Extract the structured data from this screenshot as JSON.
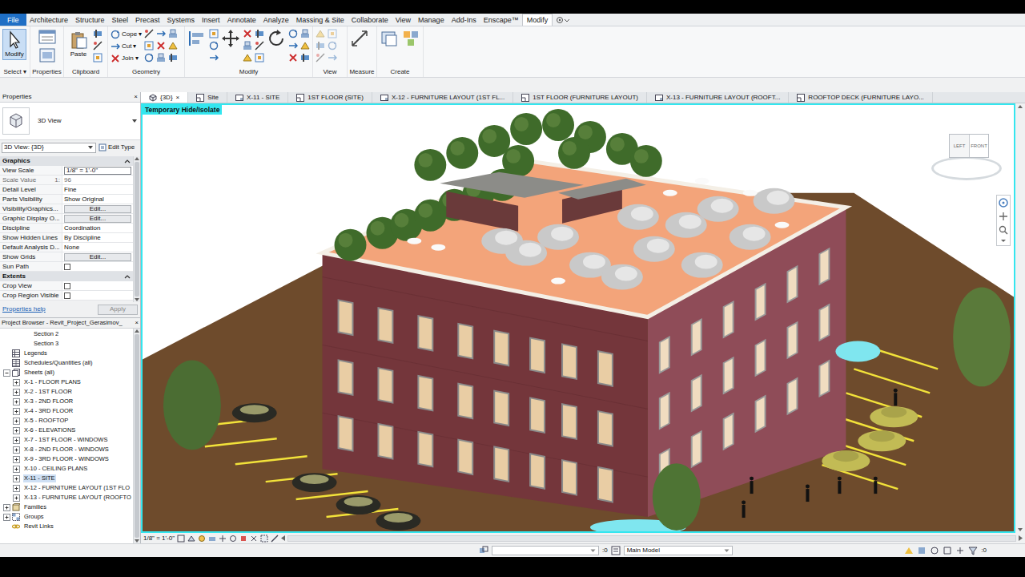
{
  "ribbon": {
    "file_tab": "File",
    "tabs": [
      {
        "label": "Architecture",
        "selected": false
      },
      {
        "label": "Structure",
        "selected": false
      },
      {
        "label": "Steel",
        "selected": false
      },
      {
        "label": "Precast",
        "selected": false
      },
      {
        "label": "Systems",
        "selected": false
      },
      {
        "label": "Insert",
        "selected": false
      },
      {
        "label": "Annotate",
        "selected": false
      },
      {
        "label": "Analyze",
        "selected": false
      },
      {
        "label": "Massing & Site",
        "selected": false
      },
      {
        "label": "Collaborate",
        "selected": false
      },
      {
        "label": "View",
        "selected": false
      },
      {
        "label": "Manage",
        "selected": false
      },
      {
        "label": "Add-Ins",
        "selected": false
      },
      {
        "label": "Enscape™",
        "selected": false
      },
      {
        "label": "Modify",
        "selected": true
      }
    ],
    "groups": [
      {
        "label": "Select",
        "dropdown": "▾",
        "tools": [
          {
            "label": "Modify",
            "selected": true
          }
        ]
      },
      {
        "label": "Properties",
        "tools": []
      },
      {
        "label": "Clipboard",
        "tools": [
          {
            "label": "Paste",
            "selected": false
          }
        ]
      },
      {
        "label": "Geometry",
        "tools": [
          {
            "label": "Cope",
            "dropdown": "▾",
            "selected": false
          },
          {
            "label": "Cut",
            "dropdown": "▾",
            "selected": false
          },
          {
            "label": "Join",
            "dropdown": "▾",
            "selected": false
          }
        ]
      },
      {
        "label": "Modify",
        "tools": []
      },
      {
        "label": "View",
        "tools": []
      },
      {
        "label": "Measure",
        "tools": []
      },
      {
        "label": "Create",
        "tools": []
      }
    ]
  },
  "properties": {
    "title": "Properties",
    "close": "×",
    "type_name": "3D View",
    "view_selector": "3D View: {3D}",
    "edit_type": "Edit Type",
    "sections": [
      {
        "label": "Graphics",
        "expanded": true,
        "rows": [
          {
            "name": "View Scale",
            "value": "1/8\" = 1'-0\"",
            "kind": "field",
            "disabled": false
          },
          {
            "name": "Scale Value",
            "prefix": "1:",
            "value": "96",
            "kind": "text",
            "disabled": true
          },
          {
            "name": "Detail Level",
            "value": "Fine",
            "kind": "text",
            "disabled": false
          },
          {
            "name": "Parts Visibility",
            "value": "Show Original",
            "kind": "text",
            "disabled": false
          },
          {
            "name": "Visibility/Graphics...",
            "value": "Edit...",
            "kind": "button",
            "disabled": false
          },
          {
            "name": "Graphic Display O...",
            "value": "Edit...",
            "kind": "button",
            "disabled": false
          },
          {
            "name": "Discipline",
            "value": "Coordination",
            "kind": "text",
            "disabled": false
          },
          {
            "name": "Show Hidden Lines",
            "value": "By Discipline",
            "kind": "text",
            "disabled": false
          },
          {
            "name": "Default Analysis D...",
            "value": "None",
            "kind": "text",
            "disabled": false
          },
          {
            "name": "Show Grids",
            "value": "Edit...",
            "kind": "button",
            "disabled": false
          },
          {
            "name": "Sun Path",
            "kind": "checkbox",
            "checked": false,
            "disabled": false
          }
        ]
      },
      {
        "label": "Extents",
        "expanded": true,
        "rows": [
          {
            "name": "Crop View",
            "kind": "checkbox",
            "checked": false,
            "disabled": false
          },
          {
            "name": "Crop Region Visible",
            "kind": "checkbox",
            "checked": false,
            "disabled": false
          }
        ]
      }
    ],
    "help": "Properties help",
    "apply": {
      "label": "Apply",
      "disabled": true
    }
  },
  "browser": {
    "title": "Project Browser - Revit_Project_Gerasimov_",
    "close": "×",
    "items": [
      {
        "label": "Section 2",
        "depth": 2,
        "kind": "view",
        "expandable": false,
        "expanded": false,
        "selected": false
      },
      {
        "label": "Section 3",
        "depth": 2,
        "kind": "view",
        "expandable": false,
        "expanded": false,
        "selected": false
      },
      {
        "label": "Legends",
        "depth": 0,
        "kind": "legend",
        "expandable": false,
        "expanded": false,
        "selected": false
      },
      {
        "label": "Schedules/Quantities (all)",
        "depth": 0,
        "kind": "schedule",
        "expandable": false,
        "expanded": false,
        "selected": false
      },
      {
        "label": "Sheets (all)",
        "depth": 0,
        "kind": "sheets",
        "expandable": true,
        "expanded": true,
        "selected": false
      },
      {
        "label": "X-1 - FLOOR PLANS",
        "depth": 1,
        "kind": "sheet",
        "expandable": true,
        "expanded": false,
        "selected": false
      },
      {
        "label": "X-2 - 1ST FLOOR",
        "depth": 1,
        "kind": "sheet",
        "expandable": true,
        "expanded": false,
        "selected": false
      },
      {
        "label": "X-3 - 2ND FLOOR",
        "depth": 1,
        "kind": "sheet",
        "expandable": true,
        "expanded": false,
        "selected": false
      },
      {
        "label": "X-4 - 3RD FLOOR",
        "depth": 1,
        "kind": "sheet",
        "expandable": true,
        "expanded": false,
        "selected": false
      },
      {
        "label": "X-5 - ROOFTOP",
        "depth": 1,
        "kind": "sheet",
        "expandable": true,
        "expanded": false,
        "selected": false
      },
      {
        "label": "X-6 - ELEVATIONS",
        "depth": 1,
        "kind": "sheet",
        "expandable": true,
        "expanded": false,
        "selected": false
      },
      {
        "label": "X-7 - 1ST FLOOR - WINDOWS",
        "depth": 1,
        "kind": "sheet",
        "expandable": true,
        "expanded": false,
        "selected": false
      },
      {
        "label": "X-8 - 2ND FLOOR - WINDOWS",
        "depth": 1,
        "kind": "sheet",
        "expandable": true,
        "expanded": false,
        "selected": false
      },
      {
        "label": "X-9 - 3RD FLOOR - WINDOWS",
        "depth": 1,
        "kind": "sheet",
        "expandable": true,
        "expanded": false,
        "selected": false
      },
      {
        "label": "X-10 - CEILING PLANS",
        "depth": 1,
        "kind": "sheet",
        "expandable": true,
        "expanded": false,
        "selected": false
      },
      {
        "label": "X-11 - SITE",
        "depth": 1,
        "kind": "sheet",
        "expandable": true,
        "expanded": false,
        "selected": true
      },
      {
        "label": "X-12 - FURNITURE LAYOUT (1ST FLO",
        "depth": 1,
        "kind": "sheet",
        "expandable": true,
        "expanded": false,
        "selected": false
      },
      {
        "label": "X-13 - FURNITURE LAYOUT (ROOFTO",
        "depth": 1,
        "kind": "sheet",
        "expandable": true,
        "expanded": false,
        "selected": false
      },
      {
        "label": "Families",
        "depth": 0,
        "kind": "family",
        "expandable": true,
        "expanded": false,
        "selected": false
      },
      {
        "label": "Groups",
        "depth": 0,
        "kind": "group",
        "expandable": true,
        "expanded": false,
        "selected": false
      },
      {
        "label": "Revit Links",
        "depth": 0,
        "kind": "link",
        "expandable": false,
        "expanded": false,
        "selected": false
      }
    ]
  },
  "view_tabs": [
    {
      "label": "{3D}",
      "kind": "3d",
      "selected": true,
      "close": "×"
    },
    {
      "label": "Site",
      "kind": "plan",
      "selected": false
    },
    {
      "label": "X-11 - SITE",
      "kind": "sheet",
      "selected": false
    },
    {
      "label": "1ST FLOOR (SITE)",
      "kind": "plan",
      "selected": false
    },
    {
      "label": "X-12 - FURNITURE LAYOUT (1ST FL...",
      "kind": "sheet",
      "selected": false
    },
    {
      "label": "1ST FLOOR (FURNITURE LAYOUT)",
      "kind": "plan",
      "selected": false
    },
    {
      "label": "X-13 - FURNITURE LAYOUT (ROOFT...",
      "kind": "sheet",
      "selected": false
    },
    {
      "label": "ROOFTOP DECK (FURNITURE LAYO...",
      "kind": "plan",
      "selected": false
    }
  ],
  "viewport": {
    "label": "Temporary Hide/Isolate",
    "viewcube": {
      "left": "LEFT",
      "front": "FRONT"
    }
  },
  "view_control": {
    "scale": "1/8\" = 1'-0\""
  },
  "status_bar": {
    "workset_count": ":0",
    "model": "Main Model",
    "filter_count": ":0"
  }
}
